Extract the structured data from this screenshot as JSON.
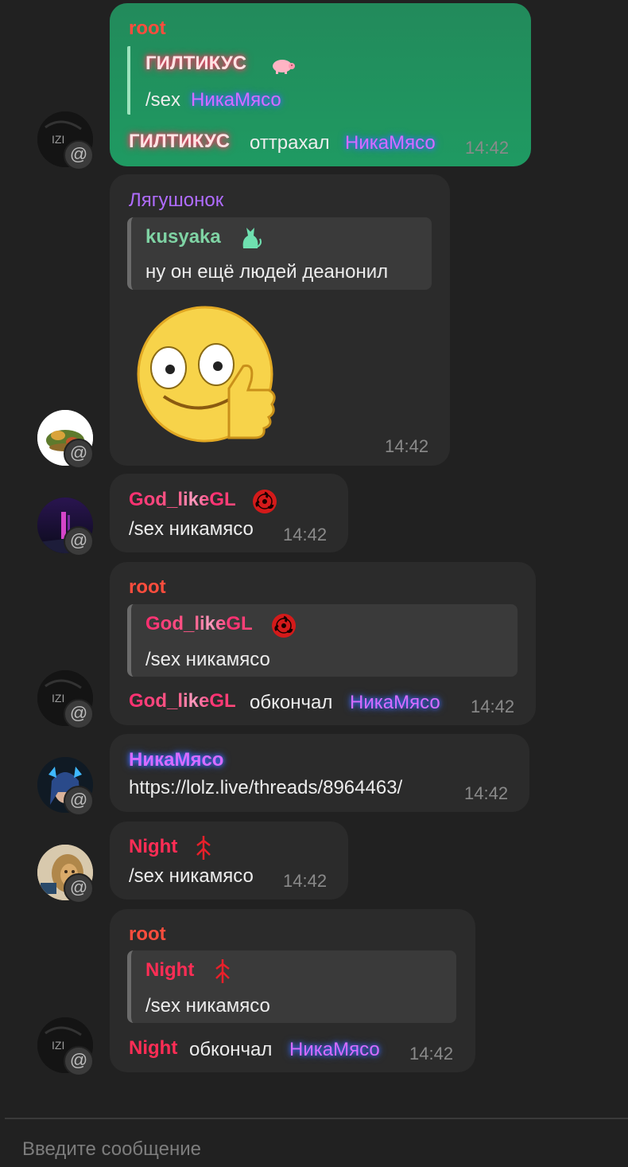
{
  "messages": [
    {
      "username": "root",
      "quote_name": "ГИЛТИКУС",
      "quote_icon": "pig-icon",
      "quote_text_cmd": "/sex",
      "quote_text_target": "НикаМясо",
      "text_actor": "ГИЛТИКУС",
      "text_action": "оттрахал",
      "text_target": "НикаМясо",
      "time": "14:42"
    },
    {
      "username": "Лягушонок",
      "quote_name": "kusyaka",
      "quote_icon": "cat-icon",
      "quote_text": "ну он ещё людей деанонил",
      "sticker": "thumbs-up-smiley-sticker",
      "time": "14:42"
    },
    {
      "username": "God_likeGL",
      "badge_icon": "sharingan-icon",
      "text": "/sex никамясо",
      "time": "14:42"
    },
    {
      "username": "root",
      "quote_name": "God_likeGL",
      "quote_icon": "sharingan-icon",
      "quote_text": "/sex никамясо",
      "text_actor": "God_likeGL",
      "text_action": "обкончал",
      "text_target": "НикаМясо",
      "time": "14:42"
    },
    {
      "username": "НикаМясо",
      "text": "https://lolz.live/threads/8964463/",
      "time": "14:42"
    },
    {
      "username": "Night",
      "badge_icon": "berserk-brand-icon",
      "text": "/sex никамясо",
      "time": "14:42"
    },
    {
      "username": "root",
      "quote_name": "Night",
      "quote_icon": "berserk-brand-icon",
      "quote_text": "/sex никамясо",
      "text_actor": "Night",
      "text_action": "обкончал",
      "text_target": "НикаМясо",
      "time": "14:42"
    }
  ],
  "avatar_badge": "@",
  "composer": {
    "placeholder": "Введите сообщение"
  },
  "colors": {
    "background": "#212121",
    "bubble": "#2b2b2b",
    "green_bubble": "#1f9a62",
    "root_name": "#ff4d3d",
    "frog_name": "#b06cff",
    "kusyaka_name": "#7fd3a4",
    "night_name": "#ff2d55"
  }
}
